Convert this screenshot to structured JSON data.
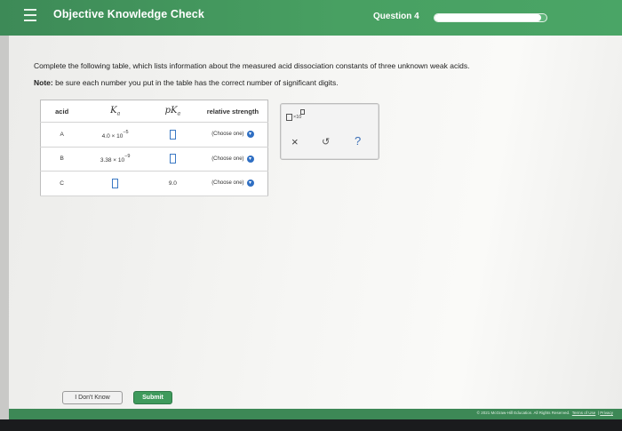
{
  "header": {
    "title": "Objective Knowledge Check",
    "question_label": "Question 4",
    "progress_fraction": 0.95
  },
  "prompt": {
    "text": "Complete the following table, which lists information about the measured acid dissociation constants of three unknown weak acids.",
    "note_label": "Note:",
    "note_text": "be sure each number you put in the table has the correct number of significant digits."
  },
  "table": {
    "headers": {
      "acid": "acid",
      "ka_symbol": "K",
      "ka_sub": "a",
      "pka_symbol": "pK",
      "pka_sub": "a",
      "strength": "relative strength"
    },
    "rows": [
      {
        "acid": "A",
        "ka_mantissa": "4.0 × 10",
        "ka_exp": "−5",
        "pka": "",
        "strength": "(Choose one)"
      },
      {
        "acid": "B",
        "ka_mantissa": "3.38 × 10",
        "ka_exp": "−9",
        "pka": "",
        "strength": "(Choose one)"
      },
      {
        "acid": "C",
        "ka_mantissa": "",
        "ka_exp": "",
        "pka": "9.0",
        "strength": "(Choose one)"
      }
    ]
  },
  "tools": {
    "sci_label": "×10",
    "clear_icon": "×",
    "undo_icon": "↺",
    "help_icon": "?"
  },
  "buttons": {
    "dont_know": "I Don't Know",
    "submit": "Submit"
  },
  "footer": {
    "copyright": "© 2021 McGraw-Hill Education. All Rights Reserved.",
    "terms": "Terms of Use",
    "privacy": "Privacy"
  },
  "colors": {
    "header_green": "#48a062",
    "input_blue": "#3b79c4",
    "submit_green": "#3f9a5c"
  }
}
